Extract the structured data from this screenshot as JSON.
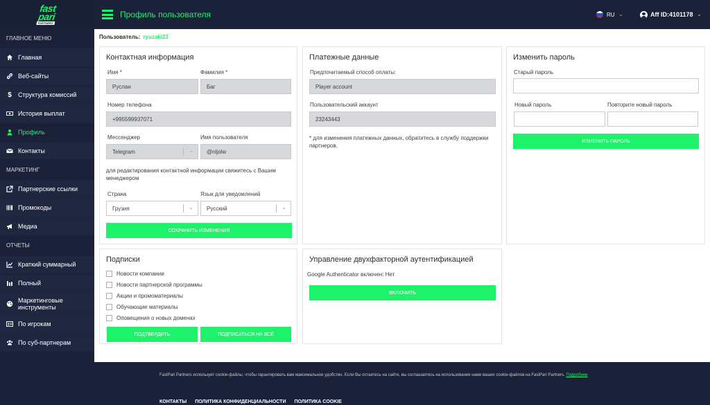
{
  "brand": {
    "logo_line1": "fast",
    "logo_line2": "pari",
    "logo_sub": "PARTNERS",
    "accent": "#1ef26b",
    "dark": "#1a2138"
  },
  "sidebar": {
    "sections": [
      {
        "title": "Главное меню",
        "items": [
          {
            "label": "Главная",
            "icon": "home-icon"
          },
          {
            "label": "Веб-сайты",
            "icon": "link-icon"
          },
          {
            "label": "Структура комиссий",
            "icon": "dollar-icon"
          },
          {
            "label": "История выплат",
            "icon": "money-icon"
          },
          {
            "label": "Профиль",
            "icon": "user-icon",
            "active": true
          },
          {
            "label": "Контакты",
            "icon": "envelope-icon"
          }
        ]
      },
      {
        "title": "Маркетинг",
        "items": [
          {
            "label": "Партнерские ссылки",
            "icon": "external-link-icon"
          },
          {
            "label": "Промокоды",
            "icon": "barcode-icon"
          },
          {
            "label": "Медиа",
            "icon": "megaphone-icon"
          }
        ]
      },
      {
        "title": "Отчеты",
        "items": [
          {
            "label": "Краткий суммарный",
            "icon": "chart-icon"
          },
          {
            "label": "Полный",
            "icon": "bar-chart-icon"
          },
          {
            "label": "Маркетинговые инструменты",
            "icon": "palette-icon"
          },
          {
            "label": "По игрокам",
            "icon": "id-card-icon"
          },
          {
            "label": "По суб-партнерам",
            "icon": "users-icon"
          }
        ]
      }
    ]
  },
  "header": {
    "title": "Профиль пользователя",
    "lang": "RU",
    "aff_id": "Aff ID:4101178"
  },
  "user": {
    "label": "Пользователь:",
    "name": "ryuzaki23"
  },
  "contact": {
    "title": "Контактная информация",
    "first_name_label": "Имя *",
    "first_name": "Руслан",
    "last_name_label": "Фамилия *",
    "last_name": "Баг",
    "phone_label": "Номер телефона",
    "phone": "+995599937071",
    "messenger_label": "Мессенджер",
    "messenger": "Telegram",
    "username_label": "Имя пользователя",
    "username": "@nljolw",
    "note": "для редактирования контактной информации свяжитесь с Вашим менеджером",
    "country_label": "Страна",
    "country": "Грузия",
    "notify_lang_label": "Язык для уведомлений",
    "notify_lang": "Русский",
    "save_button": "Сохранить изменения"
  },
  "payment": {
    "title": "Платежные данные",
    "method_label": "Предпочитаемый способ оплаты:",
    "method": "Player account",
    "account_label": "Пользовательский аккаунт",
    "account": "23243443",
    "note": "* для изменения платежных данных, обратитесь в службу поддержки партнеров."
  },
  "password": {
    "title": "Изменить пароль",
    "old_label": "Старый пароль",
    "new_label": "Новый пароль",
    "repeat_label": "Повторите новый пароль",
    "button": "Изменить пароль"
  },
  "subscriptions": {
    "title": "Подписки",
    "items": [
      "Новости компании",
      "Новости партнерской программы",
      "Акции и промоматериалы",
      "Обучающие материалы",
      "Оповещения о новых доменах"
    ],
    "confirm_button": "Подтвердить",
    "subscribe_all_button": "Подписаться на всё"
  },
  "twofa": {
    "title": "Управление двухфакторной аутентификацией",
    "status": "Google Authenticator включен: Нет",
    "button": "Включить"
  },
  "footer": {
    "text": "FastPari Partners использует cookie-файлы, чтобы гарантировать вам максимальное удобство. Если Вы остаетесь на сайте, вы соглашаетесь на использование нами ваших cookie-файлов на FastPari Partners.",
    "more_link": "Подробнее",
    "links": [
      "Контакты",
      "Политика конфиденциальности",
      "Политика cookie"
    ]
  }
}
